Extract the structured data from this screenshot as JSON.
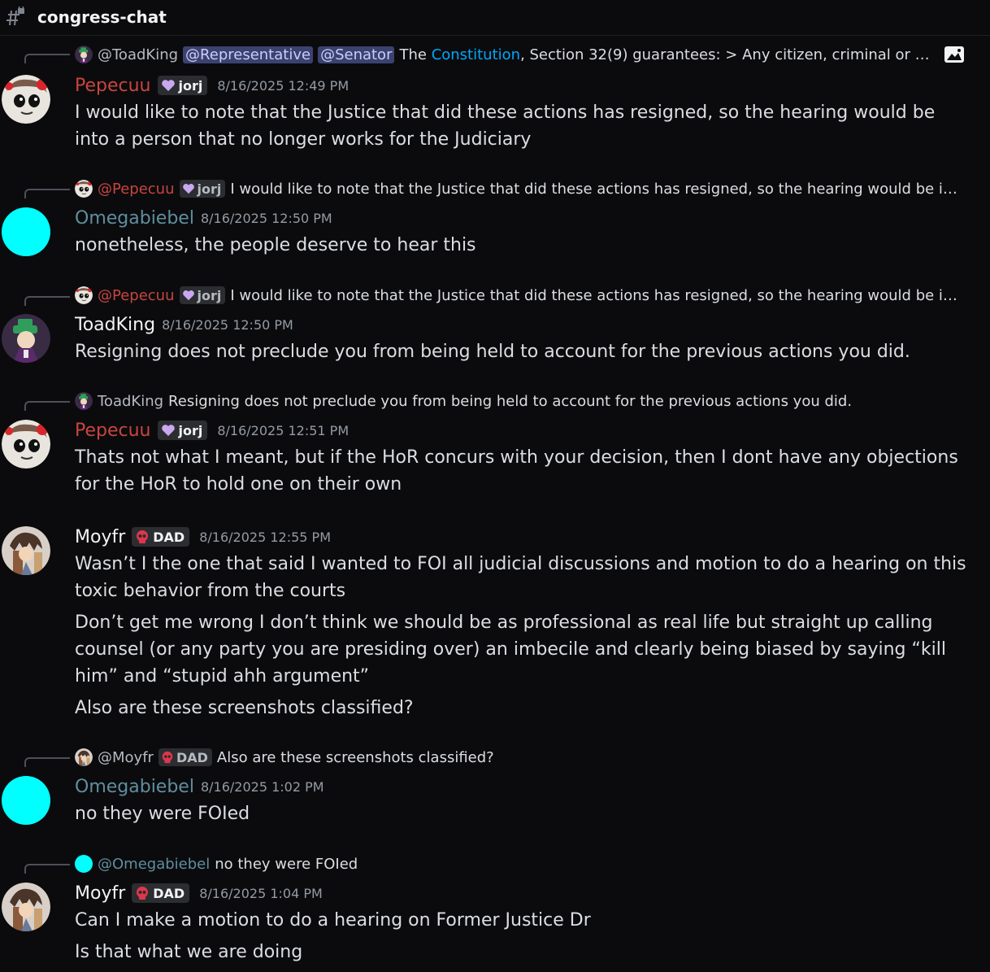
{
  "channel": {
    "name": "congress-chat",
    "icon": "hash-lock-icon"
  },
  "colors": {
    "pepecuu": "#c8453f",
    "omegabiebel": "#5f8ea0",
    "toadking": "#f2f3f5",
    "moyfr": "#f2f3f5",
    "cyan_avatar": "#00ffff"
  },
  "messages": [
    {
      "reply": {
        "mentions": [
          "@Representative",
          "@Senator"
        ],
        "author": "@ToadKing",
        "text_pre": "The ",
        "link": "Constitution",
        "text_post": ", Section 32(9) guarantees:  > Any citizen, criminal or o..."
      },
      "author": "Pepecuu",
      "tag": "jorj",
      "timestamp": "8/16/2025 12:49 PM",
      "lines": [
        "I would like to note that the Justice that did these actions has resigned, so the hearing would be into a person that no longer works for the Judiciary"
      ]
    },
    {
      "reply": {
        "author": "@Pepecuu",
        "tag": "jorj",
        "text": "I would like to note that the Justice that did these actions has resigned, so the hearing would be int..."
      },
      "author": "Omegabiebel",
      "timestamp": "8/16/2025 12:50 PM",
      "lines": [
        "nonetheless, the people deserve to hear this"
      ]
    },
    {
      "reply": {
        "author": "@Pepecuu",
        "tag": "jorj",
        "text": "I would like to note that the Justice that did these actions has resigned, so the hearing would be int..."
      },
      "author": "ToadKing",
      "timestamp": "8/16/2025 12:50 PM",
      "lines": [
        "Resigning does not preclude you from being held to account for the previous actions you did."
      ]
    },
    {
      "reply": {
        "author": "ToadKing",
        "text": "Resigning does not preclude you from being held to account for the previous actions you did."
      },
      "author": "Pepecuu",
      "tag": "jorj",
      "timestamp": "8/16/2025 12:51 PM",
      "lines": [
        "Thats not what I meant, but if the HoR concurs with your decision, then I dont have any objections for the HoR to hold one on their own"
      ]
    },
    {
      "author": "Moyfr",
      "tag": "DAD",
      "timestamp": "8/16/2025 12:55 PM",
      "lines": [
        "Wasn’t I the one that said I wanted to FOI all judicial discussions and motion to do a hearing on this toxic behavior from the courts",
        "Don’t get me wrong I don’t think we should be as professional as real life but straight up calling counsel (or any party you are presiding over) an imbecile and clearly being biased by saying “kill him” and “stupid ahh argument”",
        "Also are these screenshots classified?"
      ]
    },
    {
      "reply": {
        "author": "@Moyfr",
        "tag": "DAD",
        "text": "Also are these screenshots classified?"
      },
      "author": "Omegabiebel",
      "timestamp": "8/16/2025 1:02 PM",
      "lines": [
        "no they were FOIed"
      ]
    },
    {
      "reply": {
        "author": "@Omegabiebel",
        "text": "no they were FOIed"
      },
      "author": "Moyfr",
      "tag": "DAD",
      "timestamp": "8/16/2025 1:04 PM",
      "lines": [
        "Can I make a motion to do a hearing on Former Justice Dr",
        "Is that what we are doing"
      ]
    }
  ]
}
